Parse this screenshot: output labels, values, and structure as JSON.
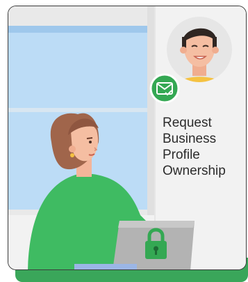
{
  "card": {
    "title_lines": [
      "Request",
      "Business",
      "Profile",
      "Ownership"
    ]
  },
  "icons": {
    "mail": "mail-check-icon",
    "lock": "lock-icon"
  },
  "colors": {
    "accent_green": "#34a853",
    "sky_blue": "#bcdcf6",
    "wall": "#f1f1f1",
    "sweater_green": "#3fbb62"
  }
}
